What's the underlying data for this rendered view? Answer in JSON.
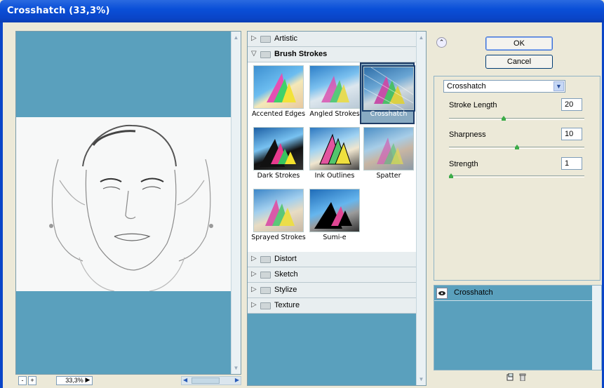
{
  "window": {
    "title": "Crosshatch (33,3%)"
  },
  "preview": {
    "zoom": "33,3%",
    "minus": "-",
    "plus": "+"
  },
  "browser": {
    "categories": [
      {
        "label": "Artistic",
        "open": false
      },
      {
        "label": "Brush Strokes",
        "open": true
      },
      {
        "label": "Distort",
        "open": false
      },
      {
        "label": "Sketch",
        "open": false
      },
      {
        "label": "Stylize",
        "open": false
      },
      {
        "label": "Texture",
        "open": false
      }
    ],
    "filters": [
      {
        "label": "Accented Edges"
      },
      {
        "label": "Angled Strokes"
      },
      {
        "label": "Crosshatch",
        "selected": true
      },
      {
        "label": "Dark Strokes"
      },
      {
        "label": "Ink Outlines"
      },
      {
        "label": "Spatter"
      },
      {
        "label": "Sprayed Strokes"
      },
      {
        "label": "Sumi-e"
      }
    ]
  },
  "right": {
    "ok": "OK",
    "cancel": "Cancel",
    "filter_select": "Crosshatch",
    "params": [
      {
        "label": "Stroke Length",
        "value": "20",
        "level": 0.4
      },
      {
        "label": "Sharpness",
        "value": "10",
        "level": 0.5
      },
      {
        "label": "Strength",
        "value": "1",
        "level": 0.0
      }
    ],
    "layer": "Crosshatch"
  },
  "colors": {
    "title_bar": "#0a4fd8",
    "panel_bg": "#5aa0bd",
    "selection": "#1e3c66"
  }
}
